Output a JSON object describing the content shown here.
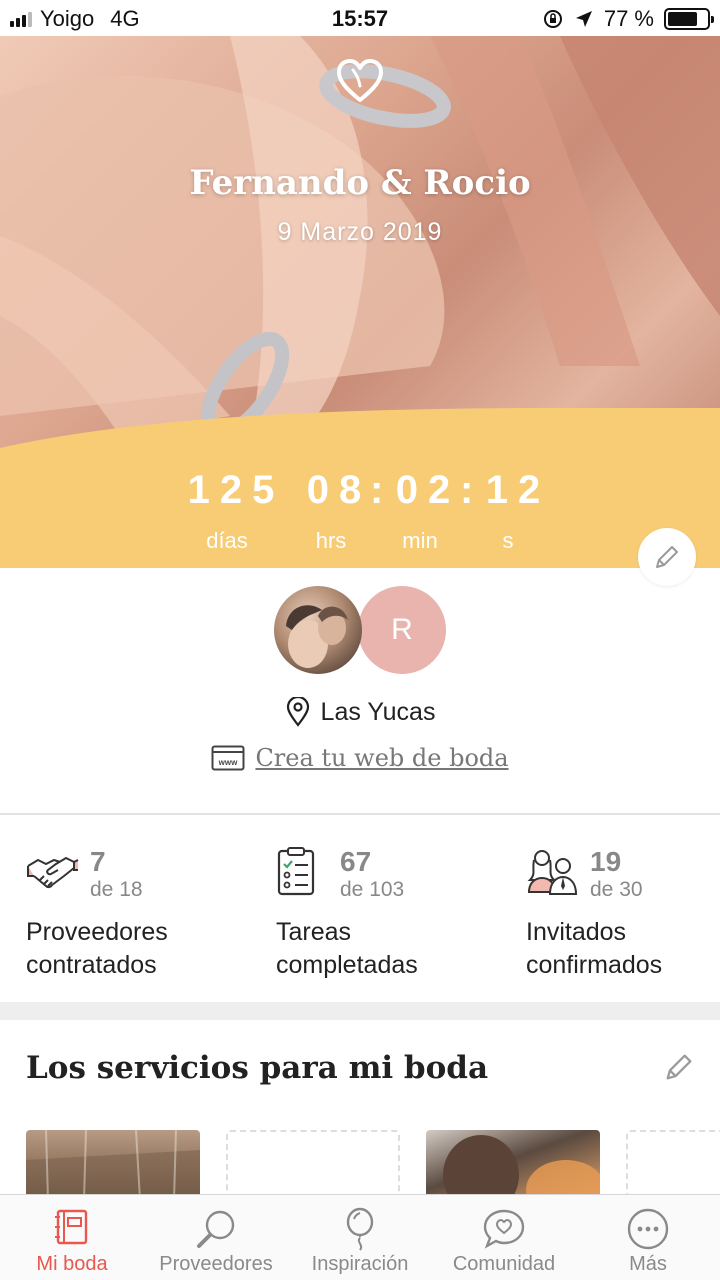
{
  "status_bar": {
    "carrier": "Yoigo",
    "network": "4G",
    "time": "15:57",
    "battery_percent_text": "77 %",
    "battery_level": 0.77
  },
  "hero": {
    "couple_names": "Fernando & Rocio",
    "date": "9 Marzo 2019",
    "accent_color": "#f7cc75",
    "countdown": {
      "days": "125",
      "hours": "08",
      "minutes": "02",
      "seconds": "12",
      "days_label": "días",
      "hours_label": "hrs",
      "minutes_label": "min",
      "seconds_label": "s"
    }
  },
  "couple": {
    "partner_initial": "R",
    "location": "Las Yucas",
    "web_link": "Crea tu web de boda"
  },
  "stats": [
    {
      "icon": "handshake-icon",
      "value": "7",
      "total": "de 18",
      "label_1": "Proveedores",
      "label_2": "contratados"
    },
    {
      "icon": "checklist-icon",
      "value": "67",
      "total": "de 103",
      "label_1": "Tareas",
      "label_2": "completadas"
    },
    {
      "icon": "guests-icon",
      "value": "19",
      "total": "de 30",
      "label_1": "Invitados",
      "label_2": "confirmados"
    }
  ],
  "services": {
    "title": "Los servicios para mi boda"
  },
  "tab_bar": {
    "active_color": "#e8584f",
    "items": [
      {
        "label": "Mi boda",
        "icon": "notebook-icon"
      },
      {
        "label": "Proveedores",
        "icon": "search-icon"
      },
      {
        "label": "Inspiración",
        "icon": "balloon-icon"
      },
      {
        "label": "Comunidad",
        "icon": "chat-heart-icon"
      },
      {
        "label": "Más",
        "icon": "more-icon"
      }
    ]
  }
}
